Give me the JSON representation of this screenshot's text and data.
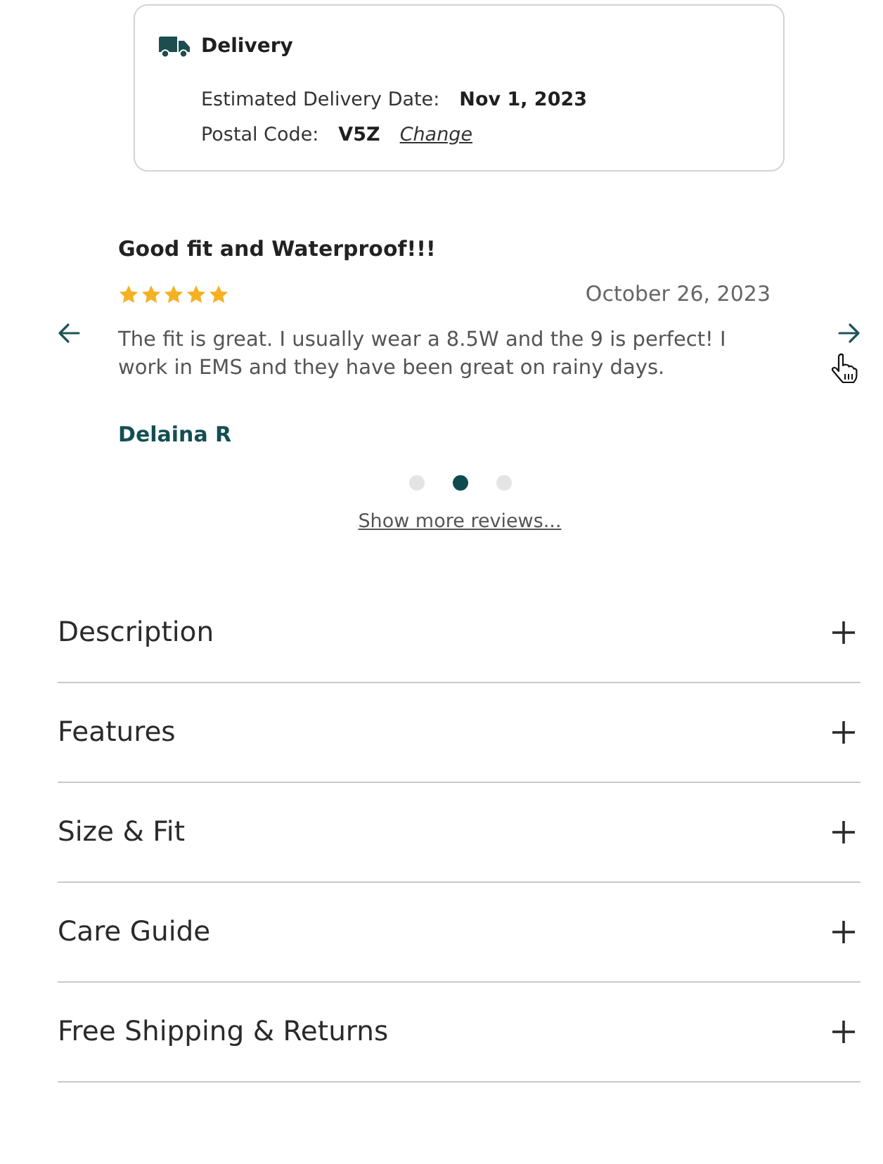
{
  "delivery": {
    "title": "Delivery",
    "rows": [
      {
        "label": "Estimated Delivery Date:",
        "value": "Nov 1, 2023"
      },
      {
        "label": "Postal Code:",
        "value": "V5Z",
        "link": "Change"
      }
    ]
  },
  "review": {
    "title": "Good fit and Waterproof!!!",
    "stars": 5,
    "date": "October 26, 2023",
    "body": "The fit is great. I usually wear a 8.5W and the 9 is perfect! I work in EMS and they have been great on rainy days.",
    "author": "Delaina R"
  },
  "carousel_dots": [
    {
      "selected": false
    },
    {
      "selected": true
    },
    {
      "selected": false
    }
  ],
  "show_more": "Show more reviews...",
  "accordion": [
    {
      "label": "Description",
      "expanded": false
    },
    {
      "label": "Features",
      "expanded": false
    },
    {
      "label": "Size & Fit",
      "expanded": false
    },
    {
      "label": "Care Guide",
      "expanded": false
    },
    {
      "label": "Free Shipping & Returns",
      "expanded": false
    }
  ]
}
